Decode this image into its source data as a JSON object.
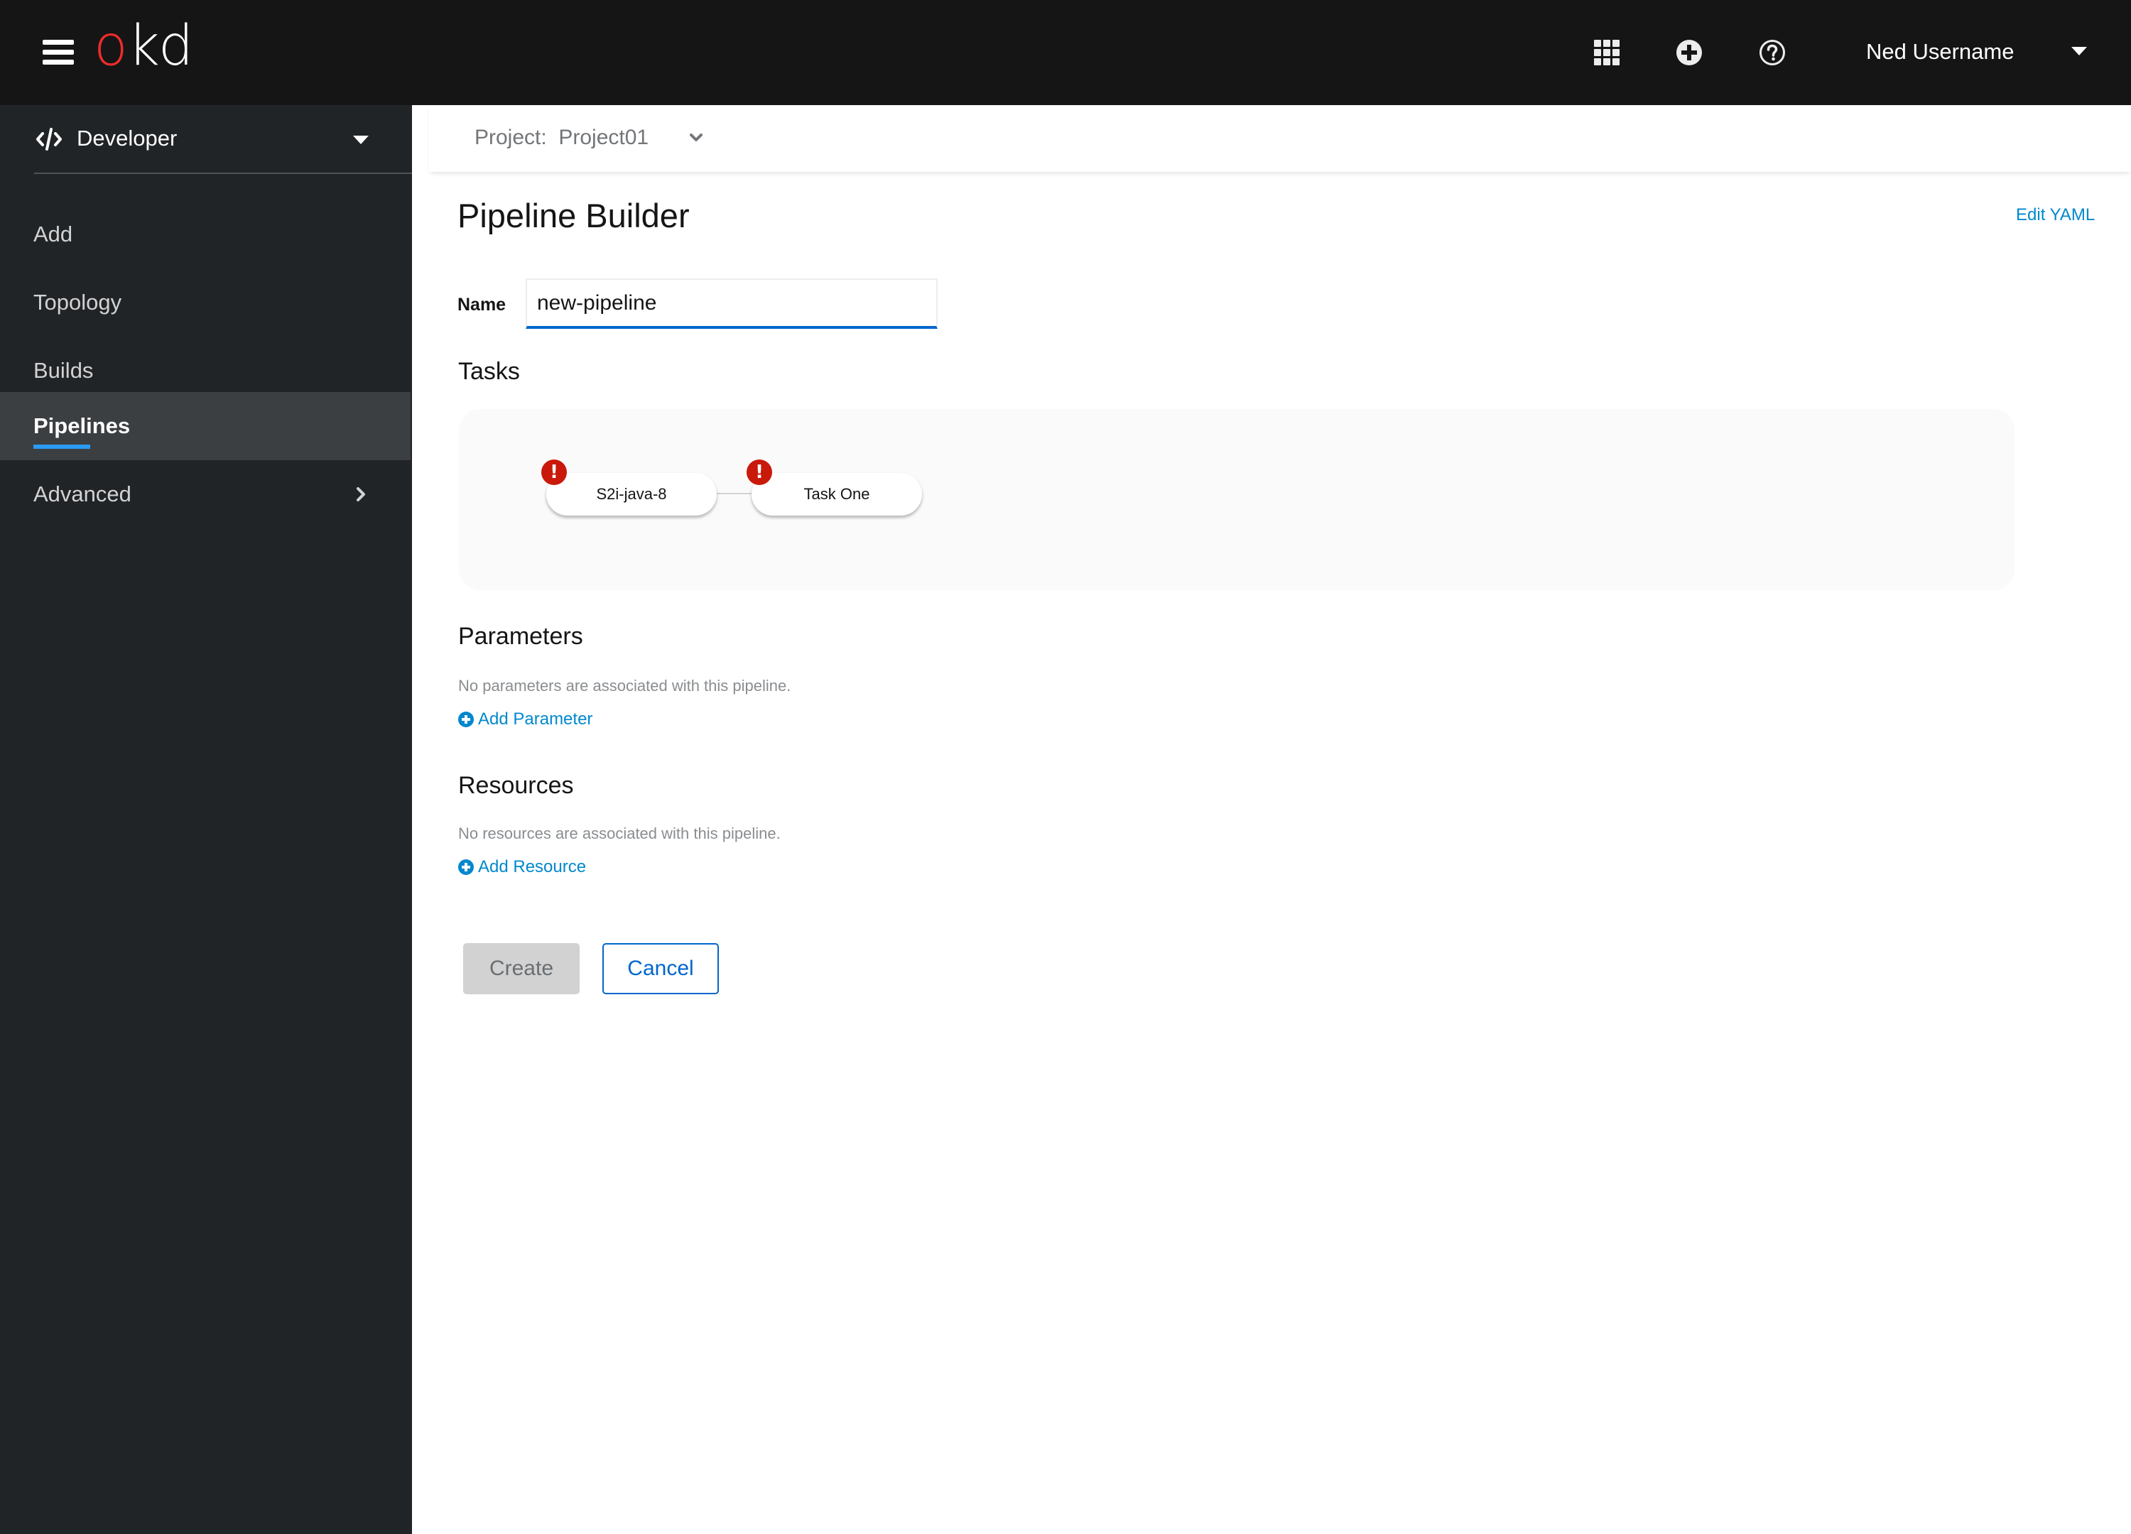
{
  "masthead": {
    "logo_part1": "o",
    "logo_part2": "kd",
    "icons": [
      "hamburger-icon",
      "app-launcher-grid-icon",
      "plus-circle-icon",
      "question-circle-icon"
    ],
    "user_name": "Ned Username"
  },
  "sidebar": {
    "perspective": {
      "icon": "code-icon",
      "label": "Developer"
    },
    "items": [
      {
        "label": "Add",
        "active": false
      },
      {
        "label": "Topology",
        "active": false
      },
      {
        "label": "Builds",
        "active": false
      },
      {
        "label": "Pipelines",
        "active": true
      },
      {
        "label": "Advanced",
        "active": false,
        "expandable": true
      }
    ]
  },
  "project_bar": {
    "label": "Project:",
    "value": "Project01",
    "text": "Project:  Project01"
  },
  "page": {
    "title": "Pipeline Builder",
    "edit_yaml": "Edit YAML",
    "name_label": "Name",
    "name_value": "new-pipeline",
    "tasks_heading": "Tasks",
    "tasks": [
      {
        "name": "S2i-java-8",
        "status": "error"
      },
      {
        "name": "Task One",
        "status": "error"
      }
    ],
    "error_glyph": "!",
    "parameters": {
      "heading": "Parameters",
      "empty_text": "No parameters are associated with this pipeline.",
      "add_label": "Add Parameter"
    },
    "resources": {
      "heading": "Resources",
      "empty_text": "No resources are associated with this pipeline.",
      "add_label": "Add Resource"
    },
    "buttons": {
      "create": "Create",
      "cancel": "Cancel"
    }
  },
  "colors": {
    "masthead_bg": "#151515",
    "sidebar_bg": "#212427",
    "active_nav_bg": "#3c3f42",
    "active_underline": "#2b9af3",
    "link": "#0088ce",
    "primary": "#0066cc",
    "error": "#c9190b",
    "logo_red": "#ee2b2b"
  }
}
